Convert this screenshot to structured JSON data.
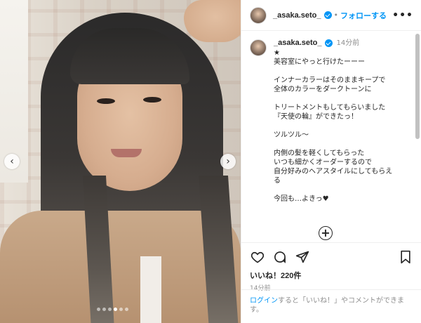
{
  "post": {
    "username": "_asaka.seto_",
    "follow_label": "フォローする",
    "separator": "•",
    "more_label": "•••",
    "caption_time": "14分前",
    "caption_lines": [
      "★",
      "美容室にやっと行けたーーー",
      "",
      "インナーカラーはそのままキープで",
      "全体のカラーをダークトーンに",
      "",
      "トリートメントもしてもらいました",
      "『天使の輪』ができたっ！",
      "",
      "ツルツル〜",
      "",
      "内側の髪を軽くしてもらった",
      "いつも細かくオーダーするので",
      "自分好みのヘアスタイルにしてもらえ",
      "る",
      "",
      "今回も…よきっ♥"
    ],
    "load_more_label": "+",
    "likes_text": "いいね！220件",
    "post_time": "14分前"
  },
  "login_prompt": {
    "link": "ログイン",
    "rest": "すると「いいね！」やコメントができます。"
  },
  "carousel": {
    "prev_label": "‹",
    "next_label": "›",
    "dot_count": 6,
    "active_index": 3
  },
  "icons": {
    "like": "heart-icon",
    "comment": "comment-icon",
    "share": "share-icon",
    "save": "bookmark-icon",
    "verified": "verified-badge-icon"
  },
  "colors": {
    "accent": "#0095f6",
    "text": "#262626",
    "muted": "#8e8e8e"
  }
}
